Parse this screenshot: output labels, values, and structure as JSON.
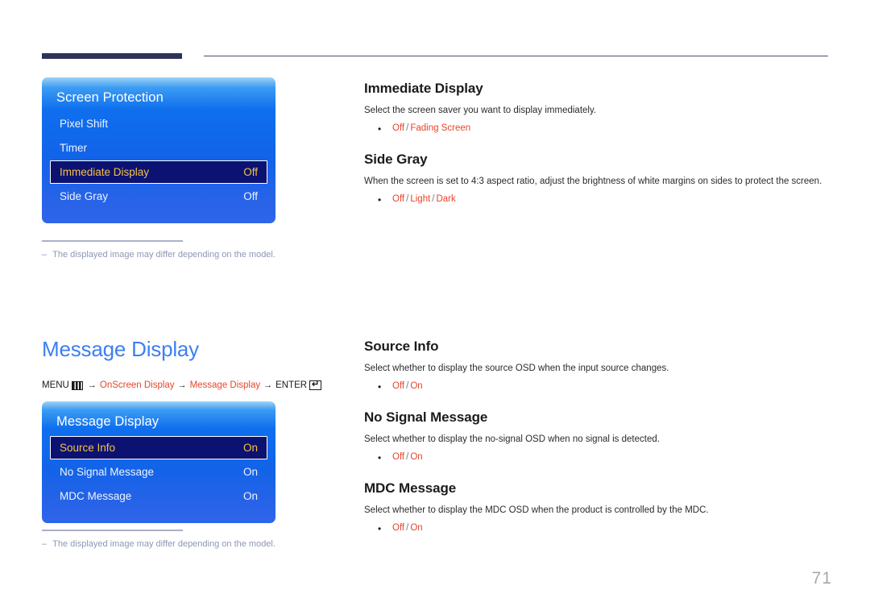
{
  "page": {
    "number": "71"
  },
  "icons": {
    "menu": "menu-grid-icon",
    "enter": "enter-return-icon",
    "arrow": "→"
  },
  "sections": [
    {
      "osd": {
        "title": "Screen Protection",
        "rows": [
          {
            "label": "Pixel Shift",
            "value": "",
            "selected": false
          },
          {
            "label": "Timer",
            "value": "",
            "selected": false
          },
          {
            "label": "Immediate Display",
            "value": "Off",
            "selected": true
          },
          {
            "label": "Side Gray",
            "value": "Off",
            "selected": false
          }
        ]
      },
      "footnote": {
        "dash": "–",
        "text": "The displayed image may differ depending on the model."
      },
      "articles": [
        {
          "heading": "Immediate Display",
          "body": "Select the screen saver you want to display immediately.",
          "options": [
            "Off",
            "Fading Screen"
          ]
        },
        {
          "heading": "Side Gray",
          "body": "When the screen is set to 4:3 aspect ratio, adjust the brightness of white margins on sides to protect the screen.",
          "options": [
            "Off",
            "Light",
            "Dark"
          ]
        }
      ]
    },
    {
      "title": "Message Display",
      "breadcrumb": {
        "menu_label": "MENU",
        "path": [
          "OnScreen Display",
          "Message Display"
        ],
        "enter_label": "ENTER"
      },
      "osd": {
        "title": "Message Display",
        "rows": [
          {
            "label": "Source Info",
            "value": "On",
            "selected": true
          },
          {
            "label": "No Signal Message",
            "value": "On",
            "selected": false
          },
          {
            "label": "MDC Message",
            "value": "On",
            "selected": false
          }
        ]
      },
      "footnote": {
        "dash": "–",
        "text": "The displayed image may differ depending on the model."
      },
      "articles": [
        {
          "heading": "Source Info",
          "body": "Select whether to display the source OSD when the input source changes.",
          "options": [
            "Off",
            "On"
          ]
        },
        {
          "heading": "No Signal Message",
          "body": "Select whether to display the no-signal OSD when no signal is detected.",
          "options": [
            "Off",
            "On"
          ]
        },
        {
          "heading": "MDC Message",
          "body": "Select whether to display the MDC OSD when the product is controlled by the MDC.",
          "options": [
            "Off",
            "On"
          ]
        }
      ]
    }
  ],
  "colors": {
    "accent_red": "#e8442a",
    "heading_blue": "#3d7ff0",
    "osd_blue": "#1263e8",
    "osd_selected_bg": "#0c1272",
    "osd_selected_text": "#f5c243",
    "rule_navy": "#2e3357"
  }
}
